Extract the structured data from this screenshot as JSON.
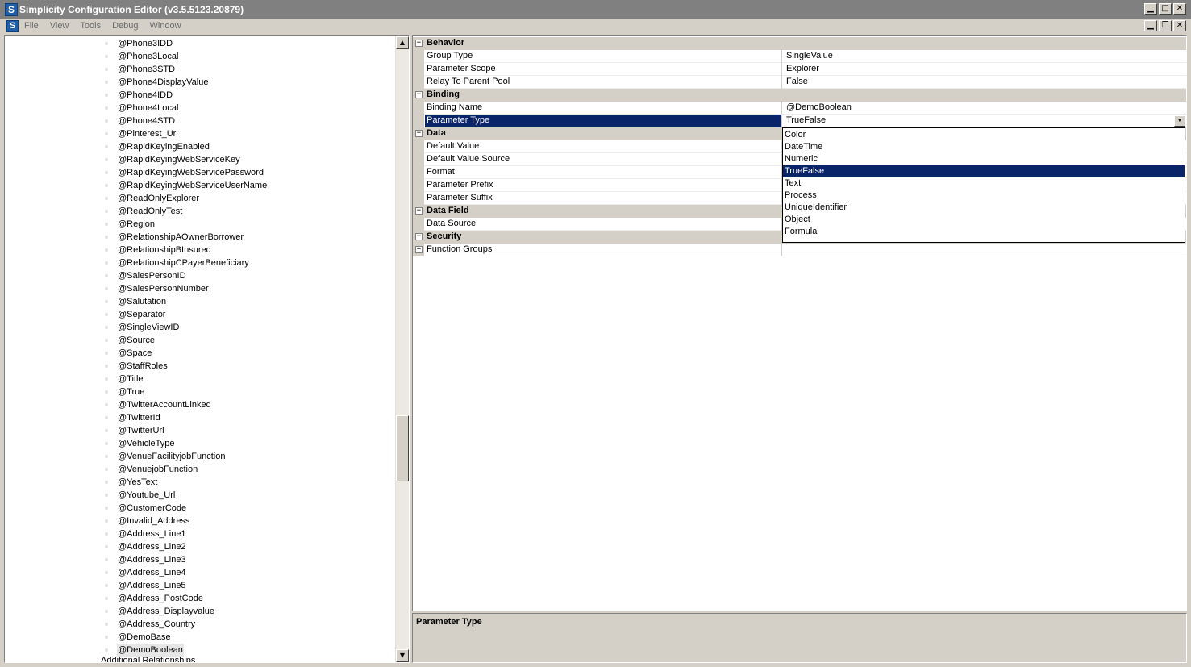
{
  "window": {
    "title": "Simplicity Configuration Editor (v3.5.5123.20879)",
    "icon_letter": "S",
    "min_glyph": "▁",
    "max_glyph": "□",
    "close_glyph": "✕",
    "restore_glyph": "❐"
  },
  "menu": {
    "items": [
      "File",
      "View",
      "Tools",
      "Debug",
      "Window"
    ]
  },
  "tree": {
    "items": [
      "@Phone3IDD",
      "@Phone3Local",
      "@Phone3STD",
      "@Phone4DisplayValue",
      "@Phone4IDD",
      "@Phone4Local",
      "@Phone4STD",
      "@Pinterest_Url",
      "@RapidKeyingEnabled",
      "@RapidKeyingWebServiceKey",
      "@RapidKeyingWebServicePassword",
      "@RapidKeyingWebServiceUserName",
      "@ReadOnlyExplorer",
      "@ReadOnlyTest",
      "@Region",
      "@RelationshipAOwnerBorrower",
      "@RelationshipBInsured",
      "@RelationshipCPayerBeneficiary",
      "@SalesPersonID",
      "@SalesPersonNumber",
      "@Salutation",
      "@Separator",
      "@SingleViewID",
      "@Source",
      "@Space",
      "@StaffRoles",
      "@Title",
      "@True",
      "@TwitterAccountLinked",
      "@TwitterId",
      "@TwitterUrl",
      "@VehicleType",
      "@VenueFacilityjobFunction",
      "@VenuejobFunction",
      "@YesText",
      "@Youtube_Url",
      "@CustomerCode",
      "@Invalid_Address",
      "@Address_Line1",
      "@Address_Line2",
      "@Address_Line3",
      "@Address_Line4",
      "@Address_Line5",
      "@Address_PostCode",
      "@Address_Displayvalue",
      "@Address_Country",
      "@DemoBase",
      "@DemoBoolean"
    ],
    "selected_item": "@DemoBoolean",
    "next_group": "Additional Relationships",
    "scroll_up": "▲",
    "scroll_down": "▼"
  },
  "properties": {
    "rows": [
      {
        "kind": "category",
        "name": "Behavior",
        "expander": "−"
      },
      {
        "kind": "prop",
        "name": "Group Type",
        "value": "SingleValue"
      },
      {
        "kind": "prop",
        "name": "Parameter Scope",
        "value": "Explorer"
      },
      {
        "kind": "prop",
        "name": "Relay To Parent Pool",
        "value": "False"
      },
      {
        "kind": "category",
        "name": "Binding",
        "expander": "−"
      },
      {
        "kind": "prop",
        "name": "Binding Name",
        "value": "@DemoBoolean"
      },
      {
        "kind": "prop",
        "name": "Parameter Type",
        "value": "TrueFalse",
        "selected": true,
        "dropdown": true
      },
      {
        "kind": "category",
        "name": "Data",
        "expander": "−"
      },
      {
        "kind": "prop",
        "name": "Default Value",
        "value": ""
      },
      {
        "kind": "prop",
        "name": "Default Value Source",
        "value": ""
      },
      {
        "kind": "prop",
        "name": "Format",
        "value": ""
      },
      {
        "kind": "prop",
        "name": "Parameter Prefix",
        "value": ""
      },
      {
        "kind": "prop",
        "name": "Parameter Suffix",
        "value": ""
      },
      {
        "kind": "category",
        "name": "Data Field",
        "expander": "−"
      },
      {
        "kind": "prop",
        "name": "Data Source",
        "value": ""
      },
      {
        "kind": "category",
        "name": "Security",
        "expander": "−"
      },
      {
        "kind": "prop",
        "name": "Function Groups",
        "value": "",
        "expander": "+"
      }
    ]
  },
  "dropdown": {
    "options": [
      "Color",
      "DateTime",
      "Numeric",
      "TrueFalse",
      "Text",
      "Process",
      "UniqueIdentifier",
      "Object",
      "Formula"
    ],
    "selected": "TrueFalse",
    "arrow": "▼"
  },
  "help": {
    "title": "Parameter Type"
  }
}
